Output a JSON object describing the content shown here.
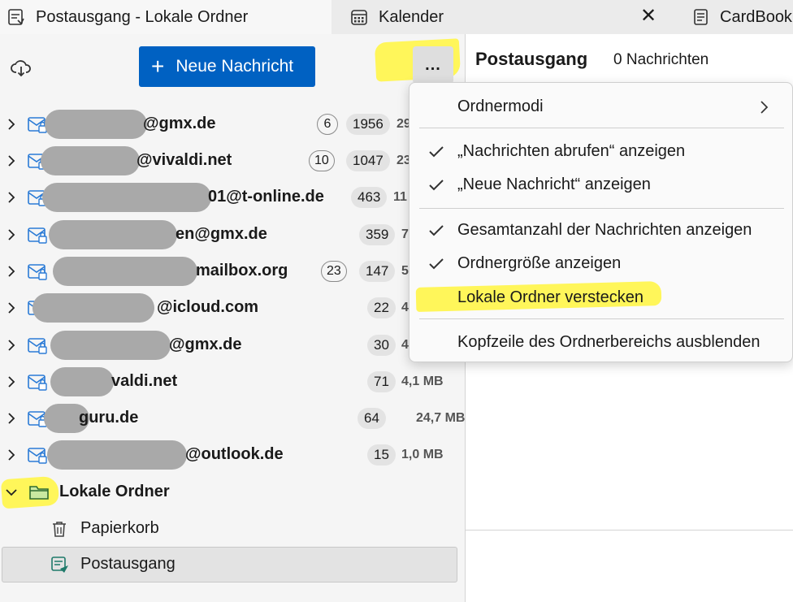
{
  "tabs": [
    {
      "label": "Postausgang - Lokale Ordner",
      "icon": "outbox-icon",
      "active": true
    },
    {
      "label": "Kalender",
      "icon": "calendar-icon",
      "active": false
    },
    {
      "label": "CardBook",
      "icon": "addressbook-icon",
      "active": false
    }
  ],
  "tab_close_label": "✕",
  "toolbar": {
    "new_message_label": "Neue Nachricht",
    "more_label": "..."
  },
  "accounts": [
    {
      "name": "@gmx.de",
      "unread": "6",
      "total": "1956",
      "size": "29"
    },
    {
      "name": "@vivaldi.net",
      "unread": "10",
      "total": "1047",
      "size": "23"
    },
    {
      "name": "01@t-online.de",
      "unread": "",
      "total": "463",
      "size": "11"
    },
    {
      "name": "en@gmx.de",
      "unread": "",
      "total": "359",
      "size": "7"
    },
    {
      "name": "mailbox.org",
      "unread": "23",
      "total": "147",
      "size": "5"
    },
    {
      "name": "@icloud.com",
      "unread": "",
      "total": "22",
      "size": "4"
    },
    {
      "name": "@gmx.de",
      "unread": "",
      "total": "30",
      "size": "4"
    },
    {
      "name": "valdi.net",
      "unread": "",
      "total": "71",
      "size": "4,1 MB"
    },
    {
      "name": "guru.de",
      "unread": "",
      "total": "64",
      "size": "24,7 MB"
    },
    {
      "name": "@outlook.de",
      "unread": "",
      "total": "15",
      "size": "1,0 MB"
    }
  ],
  "local_folders": {
    "name": "Lokale Ordner",
    "children": [
      {
        "name": "Papierkorb",
        "icon": "trash-icon"
      },
      {
        "name": "Postausgang",
        "icon": "outbox-icon",
        "selected": true
      }
    ]
  },
  "folder_header": {
    "title": "Postausgang",
    "count": "0 Nachrichten"
  },
  "menu": {
    "items": [
      {
        "label": "Ordnermodi",
        "checked": false,
        "submenu": true
      },
      {
        "label": "„Nachrichten abrufen“ anzeigen",
        "checked": true
      },
      {
        "label": "„Neue Nachricht“ anzeigen",
        "checked": true
      },
      {
        "label": "Gesamtanzahl der Nachrichten anzeigen",
        "checked": true
      },
      {
        "label": "Ordnergröße anzeigen",
        "checked": true
      },
      {
        "label": "Lokale Ordner verstecken",
        "checked": false
      },
      {
        "label": "Kopfzeile des Ordnerbereichs ausblenden",
        "checked": false
      }
    ]
  },
  "colors": {
    "accent": "#0061c2",
    "highlight": "#fff65a",
    "account_icon": "#2b7bd6",
    "folder_icon": "#3a8a3a"
  }
}
